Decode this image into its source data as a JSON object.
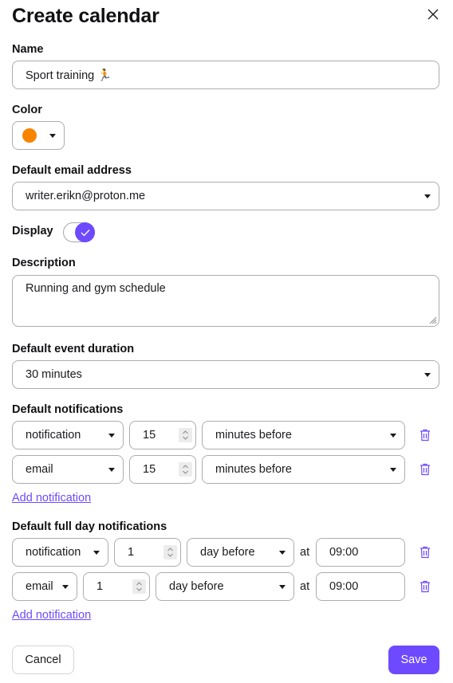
{
  "dialog": {
    "title": "Create calendar",
    "close_icon": "close-icon"
  },
  "name": {
    "label": "Name",
    "value": "Sport training 🏃"
  },
  "color": {
    "label": "Color",
    "selected_color": "#f78400"
  },
  "email": {
    "label": "Default email address",
    "value": "writer.erikn@proton.me"
  },
  "display": {
    "label": "Display",
    "enabled": true
  },
  "description": {
    "label": "Description",
    "value": "Running and gym schedule"
  },
  "duration": {
    "label": "Default event duration",
    "value": "30 minutes"
  },
  "notifications": {
    "label": "Default notifications",
    "rows": [
      {
        "type": "notification",
        "amount": "15",
        "unit": "minutes before"
      },
      {
        "type": "email",
        "amount": "15",
        "unit": "minutes before"
      }
    ],
    "add_label": "Add notification"
  },
  "fullday": {
    "label": "Default full day notifications",
    "at_label": "at",
    "rows": [
      {
        "type": "notification",
        "amount": "1",
        "unit": "day before",
        "time": "09:00"
      },
      {
        "type": "email",
        "amount": "1",
        "unit": "day before",
        "time": "09:00"
      }
    ],
    "add_label": "Add notification"
  },
  "footer": {
    "cancel_label": "Cancel",
    "save_label": "Save"
  },
  "colors": {
    "accent": "#6d4aff",
    "border": "#adadad"
  }
}
